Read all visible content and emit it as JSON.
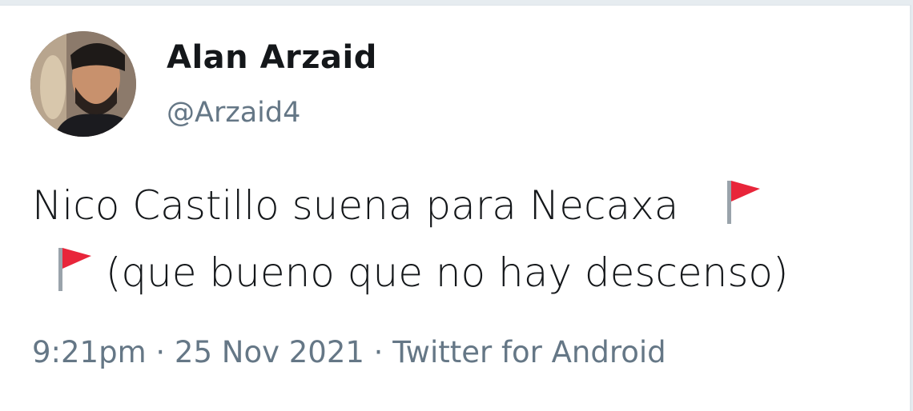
{
  "tweet": {
    "display_name": "Alan Arzaid",
    "handle": "@Arzaid4",
    "text_line1": "Nico Castillo suena para Necaxa",
    "text_line2": "(que bueno que no hay descenso)",
    "flag_icon": "red-flag-emoji",
    "time": "9:21pm",
    "date": "25 Nov 2021",
    "source": "Twitter for Android",
    "separator": "·"
  },
  "colors": {
    "text": "#14171a",
    "muted": "#657786",
    "flag": "#e8253a"
  }
}
